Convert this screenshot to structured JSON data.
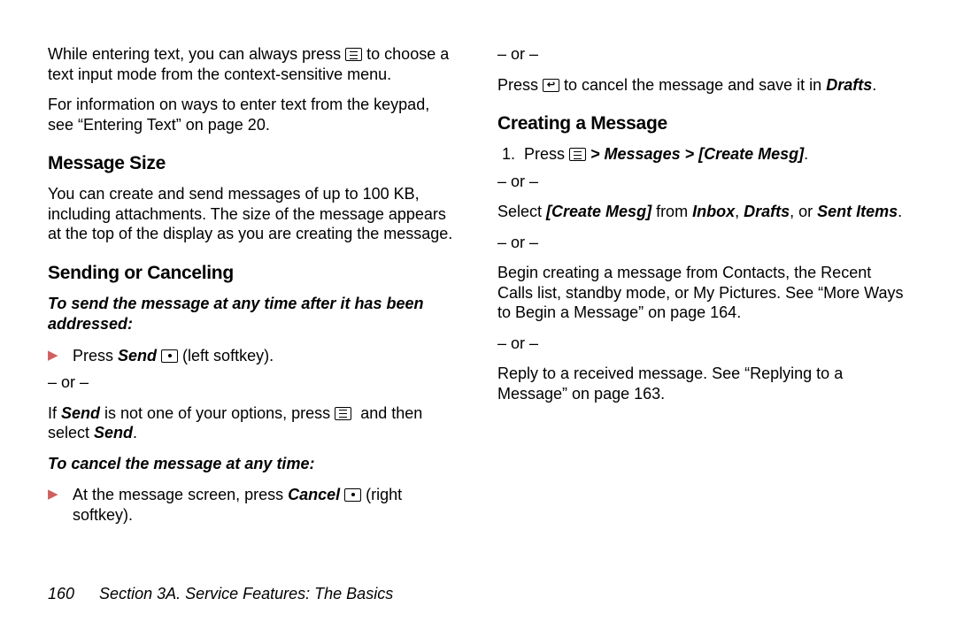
{
  "left": {
    "intro1a": "While entering text, you can always press ",
    "intro1b": " to choose a text input mode from the context-sensitive menu.",
    "intro2": "For information on ways to enter text from the keypad, see “Entering Text” on page 20.",
    "h_size": "Message Size",
    "size_body": "You can create and send messages of up to 100 KB, including attachments. The size of the message appears at the top of the display as you are creating the message.",
    "h_sending": "Sending or Canceling",
    "sub_send": "To send the message at any time after it has been addressed:",
    "send_a": "Press ",
    "send_b": "Send",
    "send_c": " ",
    "send_d": " (left softkey).",
    "or": "– or –",
    "send2a": "If ",
    "send2b": "Send",
    "send2c": " is not one of your options, press ",
    "send2d": " and then select ",
    "send2e": "Send",
    "send2f": ".",
    "sub_cancel": "To cancel the message at any time:",
    "cancel_a": "At the message screen, press ",
    "cancel_b": "Cancel",
    "cancel_c": " ",
    "cancel_d": " (right softkey)."
  },
  "right": {
    "or": "– or –",
    "back_a": "Press ",
    "back_b": " to cancel the message and save it in ",
    "back_c": "Drafts",
    "back_d": ".",
    "h_creating": "Creating a Message",
    "num1": "1.",
    "step1a": "Press ",
    "step1b": " > ",
    "step1c": "Messages",
    "step1d": " > ",
    "step1e": "[Create Mesg]",
    "step1f": ".",
    "alt1a": "Select ",
    "alt1b": "[Create Mesg]",
    "alt1c": " from ",
    "alt1d": "Inbox",
    "alt1e": ", ",
    "alt1f": "Drafts",
    "alt1g": ", or ",
    "alt1h": "Sent Items",
    "alt1i": ".",
    "alt2": "Begin creating a message from Contacts, the Recent Calls list, standby mode, or My Pictures. See “More Ways to Begin a Message” on page 164.",
    "alt3": "Reply to a received message. See “Replying to a Message” on page 163."
  },
  "footer": {
    "pagenum": "160",
    "section": "Section 3A. Service Features: The Basics"
  }
}
